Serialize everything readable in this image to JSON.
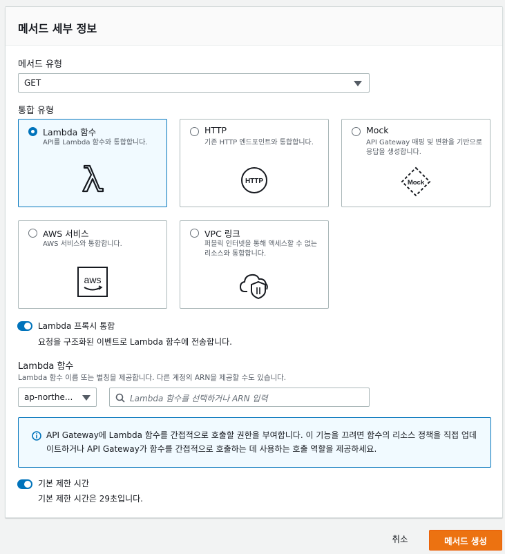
{
  "panel": {
    "title": "메서드 세부 정보"
  },
  "method_type": {
    "label": "메서드 유형",
    "value": "GET"
  },
  "integration_type": {
    "label": "통합 유형",
    "options": [
      {
        "title": "Lambda 함수",
        "description": "API를 Lambda 함수와 통합합니다.",
        "icon": "lambda-icon",
        "selected": true
      },
      {
        "title": "HTTP",
        "description": "기존 HTTP 엔드포인트와 통합합니다.",
        "icon": "http-icon",
        "icon_text": "HTTP",
        "selected": false
      },
      {
        "title": "Mock",
        "description": "API Gateway 매핑 및 변환을 기반으로 응답을 생성합니다.",
        "icon": "mock-icon",
        "icon_text": "Mock",
        "selected": false
      },
      {
        "title": "AWS 서비스",
        "description": "AWS 서비스와 통합합니다.",
        "icon": "aws-icon",
        "icon_text": "aws",
        "selected": false
      },
      {
        "title": "VPC 링크",
        "description": "퍼블릭 인터넷을 통해 액세스할 수 없는 리소스와 통합합니다.",
        "icon": "cloud-shield-icon",
        "selected": false
      }
    ]
  },
  "proxy": {
    "label": "Lambda 프록시 통합",
    "description": "요청을 구조화된 이벤트로 Lambda 함수에 전송합니다.",
    "enabled": true
  },
  "lambda_function": {
    "label": "Lambda 함수",
    "description": "Lambda 함수 이름 또는 별칭을 제공합니다. 다른 계정의 ARN을 제공할 수도 있습니다.",
    "region": "ap-northe...",
    "placeholder": "Lambda 함수를 선택하거나 ARN 입력"
  },
  "info": {
    "text": "API Gateway에 Lambda 함수를 간접적으로 호출할 권한을 부여합니다. 이 기능을 끄려면 함수의 리소스 정책을 직접 업데이트하거나 API Gateway가 함수를 간접적으로 호출하는 데 사용하는 호출 역할을 제공하세요."
  },
  "timeout": {
    "label": "기본 제한 시간",
    "description": "기본 제한 시간은 29초입니다.",
    "enabled": true
  },
  "footer": {
    "cancel": "취소",
    "submit": "메서드 생성"
  },
  "colors": {
    "accent": "#0073bb",
    "primary": "#ec7211"
  }
}
